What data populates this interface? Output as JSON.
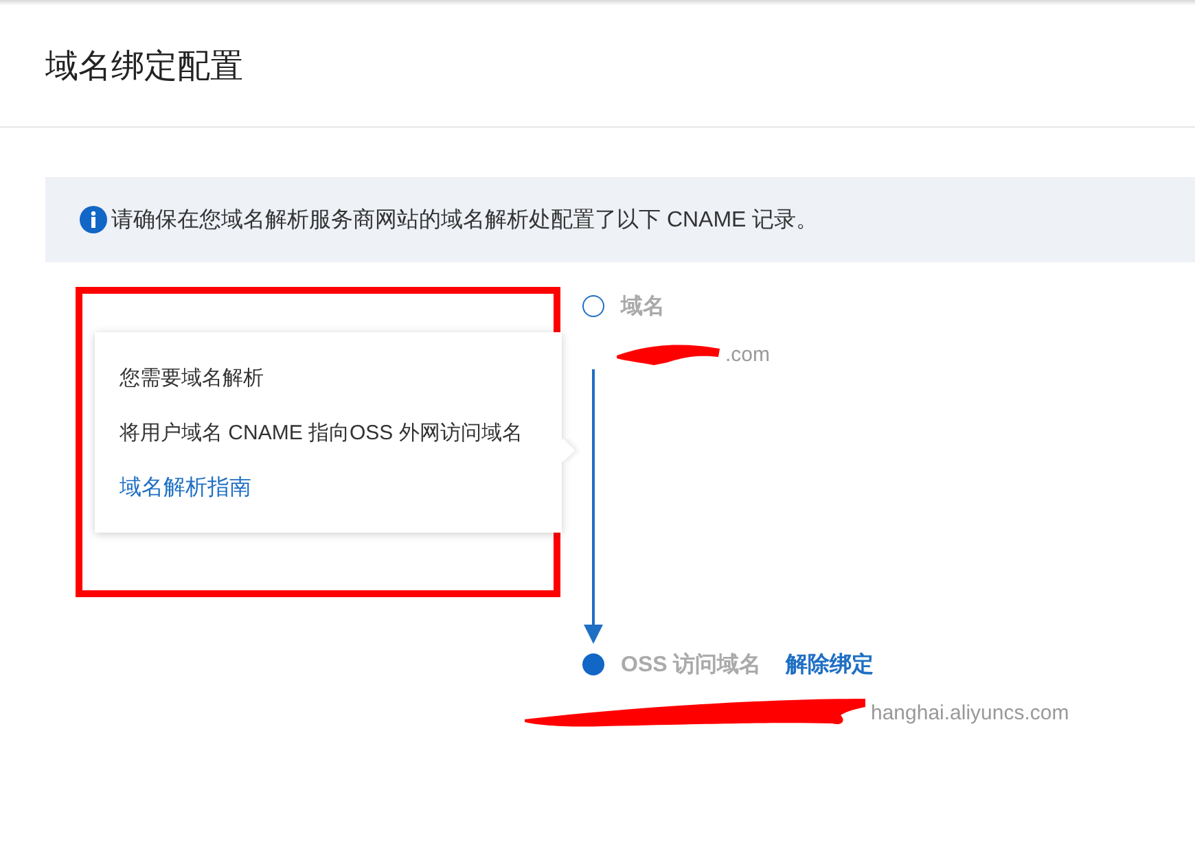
{
  "page": {
    "title": "域名绑定配置"
  },
  "notice": {
    "text": "请确保在您域名解析服务商网站的域名解析处配置了以下 CNAME 记录。"
  },
  "popover": {
    "highlighted": true,
    "title": "您需要域名解析",
    "body": "将用户域名 CNAME 指向OSS 外网访问域名",
    "link": "域名解析指南"
  },
  "steps": [
    {
      "kind": "hollow",
      "label": "域名",
      "value": ".com",
      "redacted": true
    },
    {
      "kind": "filled",
      "label": "OSS 访问域名",
      "action": "解除绑定",
      "value": "hanghai.aliyuncs.com",
      "redacted": true
    }
  ]
}
